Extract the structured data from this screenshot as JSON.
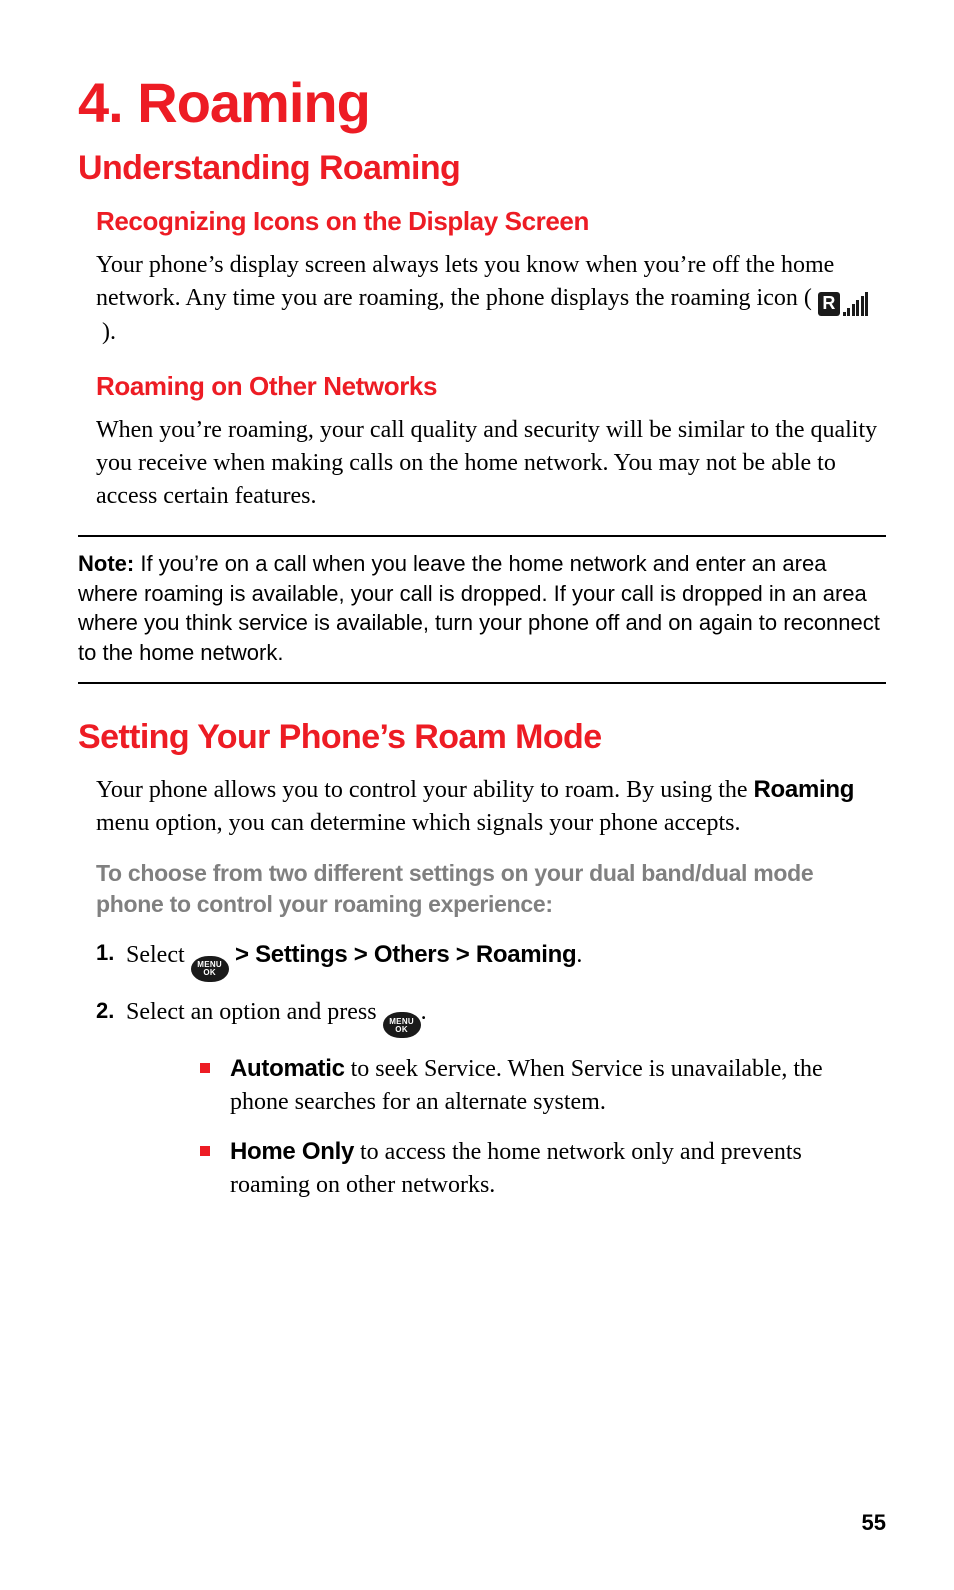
{
  "chapter": {
    "number": "4.",
    "title": "Roaming"
  },
  "section1": {
    "heading": "Understanding Roaming",
    "sub1": {
      "heading": "Recognizing Icons on the Display Screen",
      "p_before": "Your phone’s display screen always lets you know when you’re off the home network. Any time you are roaming, the phone displays the roaming icon ( ",
      "p_after": " )."
    },
    "sub2": {
      "heading": "Roaming on Other Networks",
      "p": "When you’re roaming, your call quality and security will be similar to the quality you receive when making calls on the home network. You may not be able to access certain features."
    }
  },
  "note": {
    "label": "Note:",
    "text": " If you’re on a call when you leave the home network and enter an area where roaming is available, your call is dropped. If your call is dropped in an area where you think service is available, turn your phone off and on again to reconnect to the home network."
  },
  "section2": {
    "heading": "Setting Your Phone’s Roam Mode",
    "p_before": "Your phone allows you to control your ability to roam. By using the ",
    "p_bold": "Roaming",
    "p_after": " menu option, you can determine which signals your phone accepts.",
    "instr_lead": "To choose from two different settings on your dual band/dual mode phone to control your roaming experience:",
    "step1": {
      "before": "Select ",
      "path": " > Settings > Others > Roaming",
      "after": "."
    },
    "step2": {
      "before": "Select an option and press ",
      "after": "."
    },
    "bullet1": {
      "bold": "Automatic",
      "rest": " to seek Service. When Service is unavailable, the phone searches for an alternate system."
    },
    "bullet2": {
      "bold": "Home Only",
      "rest": " to access the home network only and prevents roaming on other networks."
    }
  },
  "icons": {
    "r_letter": "R",
    "menu_top": "MENU",
    "menu_bottom": "OK"
  },
  "page_number": "55"
}
